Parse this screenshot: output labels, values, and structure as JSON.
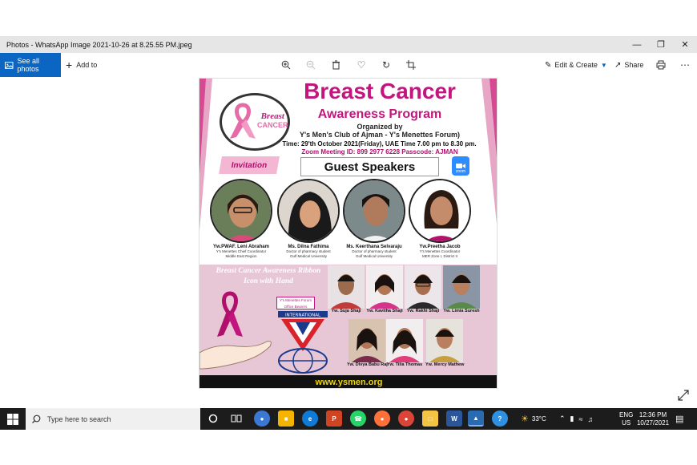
{
  "window": {
    "title": "Photos - WhatsApp Image 2021-10-26 at 8.25.55 PM.jpeg"
  },
  "toolbar": {
    "see_all": "See all photos",
    "add_to": "Add to",
    "edit_create": "Edit & Create",
    "share": "Share"
  },
  "poster": {
    "title_line1": "Breast Cancer",
    "title_line2": "Awareness Program",
    "organized_by": "Organized by",
    "organizers": "Y's Men's Club of Ajman - Y's Menettes Forum)",
    "time": "Time: 29'th October 2021(Friday), UAE Time 7.00 pm to 8.30 pm.",
    "zoom": "Zoom Meeting ID: 899 2977 6228    Passcode: AJMAN",
    "invitation": "Invitation",
    "guest_speakers": "Guest Speakers",
    "zoom_logo": "zoom",
    "ribbon_logo_line1": "Breast",
    "ribbon_logo_line2": "CANCER",
    "speakers": [
      {
        "name": "Yw.PWAF. Leni Abraham",
        "role1": "Y's Menettes Chief Coordinator",
        "role2": "Middle East Region"
      },
      {
        "name": "Ms. Dilna Fathima",
        "role1": "Doctor of pharmacy student",
        "role2": "Gulf Medical University"
      },
      {
        "name": "Ms. Keerthana Selvaraju",
        "role1": "Doctor of pharmacy student",
        "role2": "Gulf Medical University"
      },
      {
        "name": "Yw.Preetha Jacob",
        "role1": "Y's Menettes Coordinator",
        "role2": "MER Zone I, District II"
      }
    ],
    "ribbon_title_line1": "Breast Cancer Awareness Ribbon",
    "ribbon_title_line2": "Icon with Hand",
    "forum_badge_line1": "Y's Menettes Forum",
    "forum_badge_line2": "Office Bearers",
    "emblem_text": "INTERNATIONAL",
    "members_row1": [
      "Yw. Suja Shaji",
      "Yw. Kavitha Shaji",
      "Yw. Rakhi Shaji",
      "Yw. Limia Suresh"
    ],
    "members_row2": [
      "Yw. Divya Babu Raj",
      "Yw. Tilia Thomas",
      "Yw. Mercy Mathew"
    ],
    "website": "www.ysmen.org"
  },
  "taskbar": {
    "search_placeholder": "Type here to search",
    "weather": "33°C",
    "language_line1": "ENG",
    "language_line2": "US",
    "time": "12:36 PM",
    "date": "10/27/2021"
  },
  "colors": {
    "accent_blue": "#0a66c2",
    "poster_pink": "#c2167e",
    "taskbar": "#1c1c1c"
  }
}
